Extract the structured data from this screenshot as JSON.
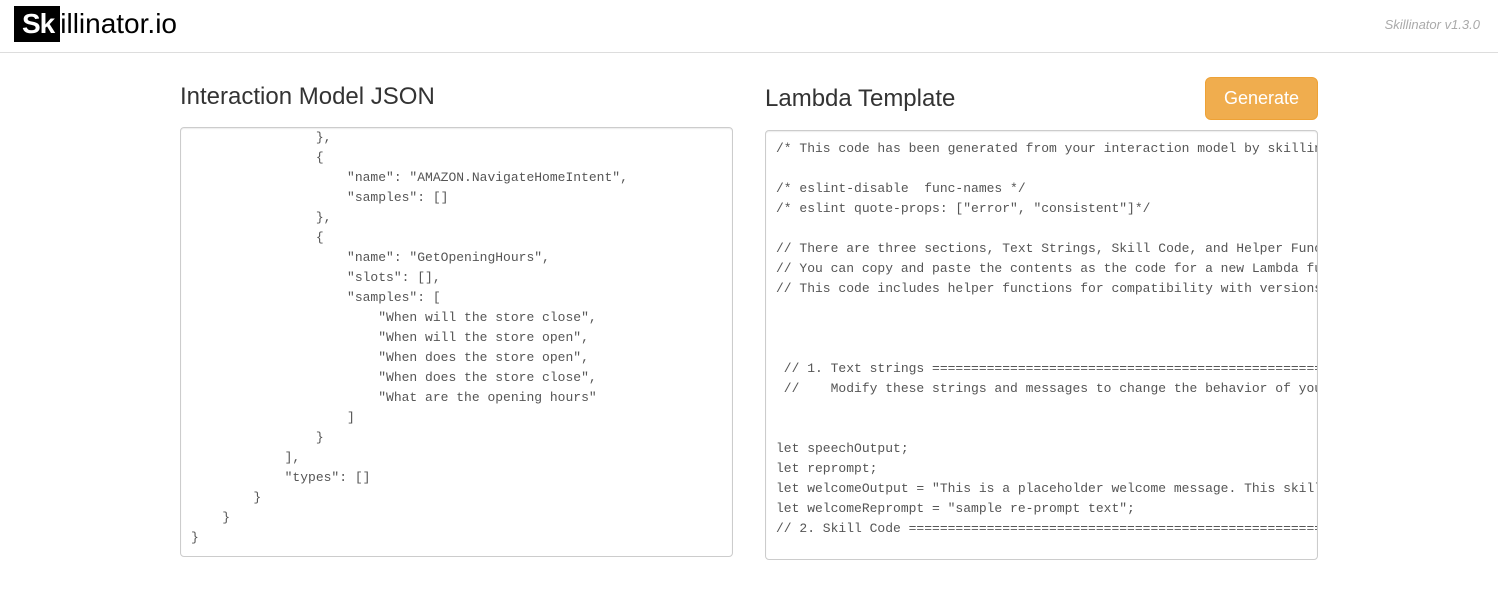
{
  "header": {
    "logo_prefix": "Sk",
    "logo_suffix": "illinator.io",
    "version": "Skillinator v1.3.0"
  },
  "left": {
    "title": "Interaction Model JSON",
    "content": "                },\n                {\n                    \"name\": \"AMAZON.NavigateHomeIntent\",\n                    \"samples\": []\n                },\n                {\n                    \"name\": \"GetOpeningHours\",\n                    \"slots\": [],\n                    \"samples\": [\n                        \"When will the store close\",\n                        \"When will the store open\",\n                        \"When does the store open\",\n                        \"When does the store close\",\n                        \"What are the opening hours\"\n                    ]\n                }\n            ],\n            \"types\": []\n        }\n    }\n}"
  },
  "right": {
    "title": "Lambda Template",
    "generate_label": "Generate",
    "content": "/* This code has been generated from your interaction model by skillinator.io\n\n/* eslint-disable  func-names */\n/* eslint quote-props: [\"error\", \"consistent\"]*/\n\n// There are three sections, Text Strings, Skill Code, and Helper Function(s).\n// You can copy and paste the contents as the code for a new Lambda function, u\n// This code includes helper functions for compatibility with versions of the SDK pr\n\n\n\n // 1. Text strings =====================================================================\n //    Modify these strings and messages to change the behavior of your Lambda f\n\n\nlet speechOutput;\nlet reprompt;\nlet welcomeOutput = \"This is a placeholder welcome message. This skill includes t\nlet welcomeReprompt = \"sample re-prompt text\";\n// 2. Skill Code ======================================================================="
  }
}
